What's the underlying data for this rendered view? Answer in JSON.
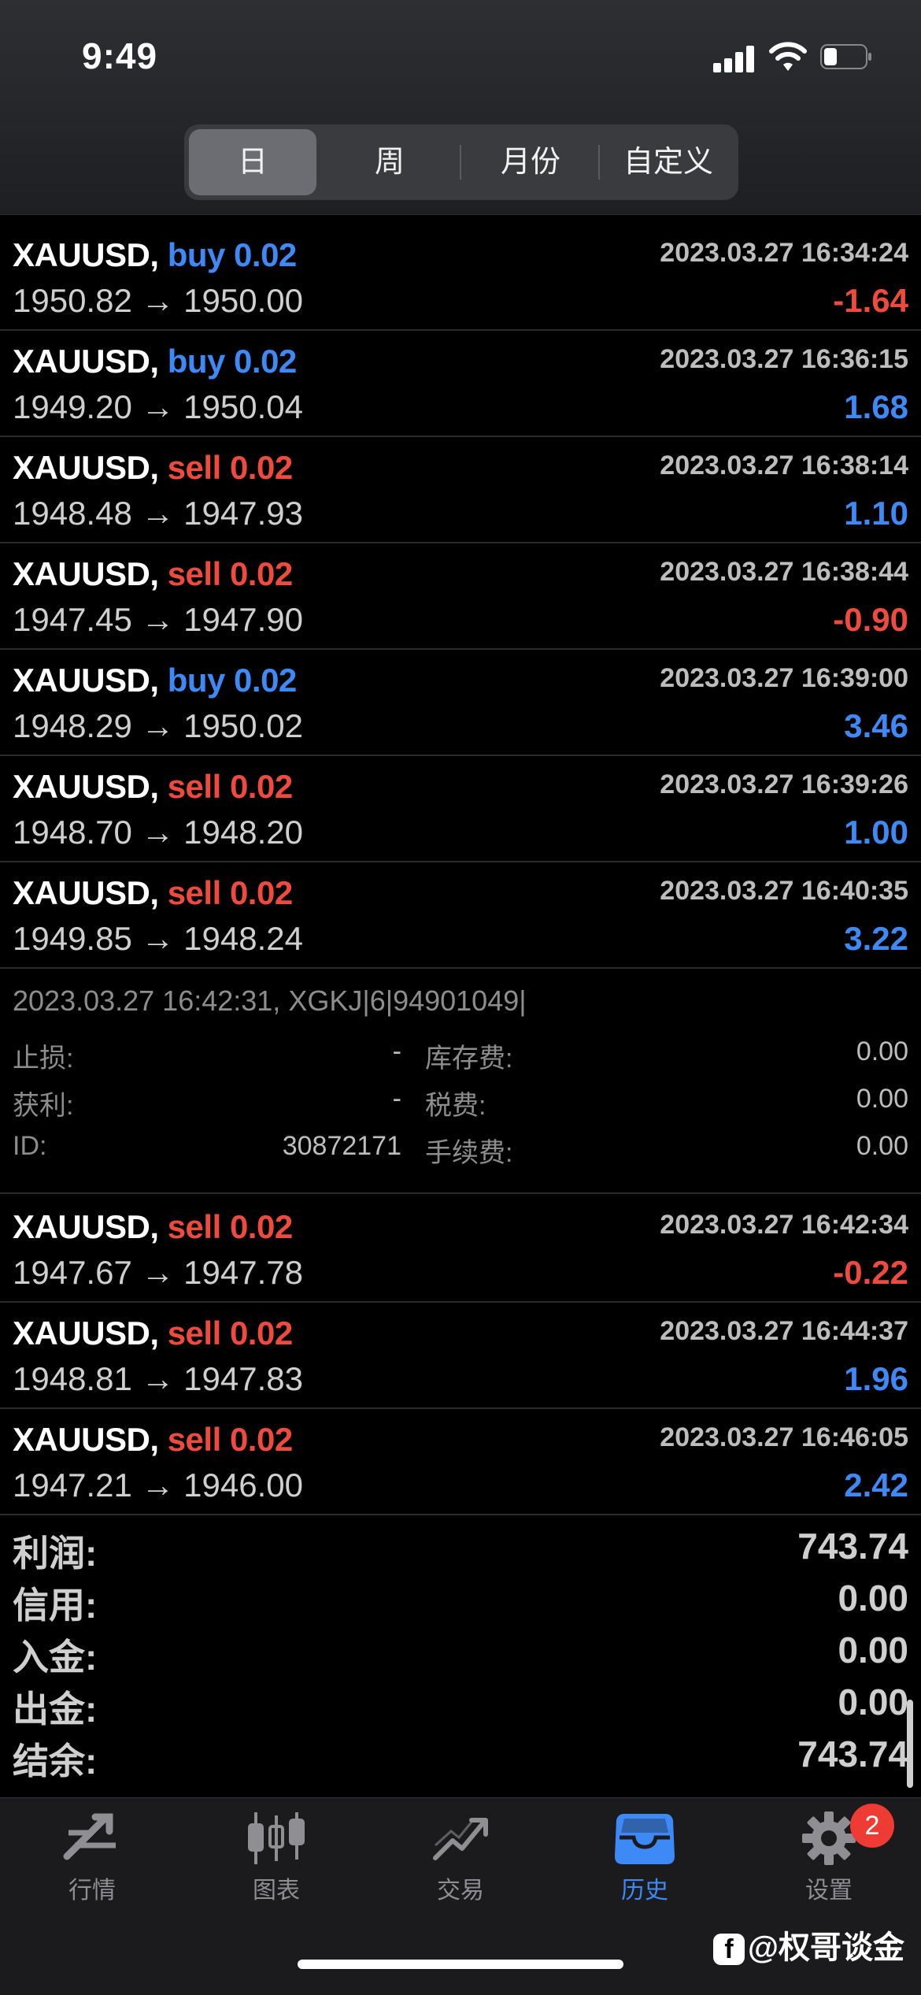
{
  "status_bar": {
    "time": "9:49"
  },
  "period_tabs": [
    "日",
    "周",
    "月份",
    "自定义"
  ],
  "active_period": "日",
  "trades_before": [
    {
      "symbol": "XAUUSD,",
      "side": "buy",
      "volume": "0.02",
      "time": "2023.03.27 16:34:24",
      "prices": "1950.82 → 1950.00",
      "profit": "-1.64"
    },
    {
      "symbol": "XAUUSD,",
      "side": "buy",
      "volume": "0.02",
      "time": "2023.03.27 16:36:15",
      "prices": "1949.20 → 1950.04",
      "profit": "1.68"
    },
    {
      "symbol": "XAUUSD,",
      "side": "sell",
      "volume": "0.02",
      "time": "2023.03.27 16:38:14",
      "prices": "1948.48 → 1947.93",
      "profit": "1.10"
    },
    {
      "symbol": "XAUUSD,",
      "side": "sell",
      "volume": "0.02",
      "time": "2023.03.27 16:38:44",
      "prices": "1947.45 → 1947.90",
      "profit": "-0.90"
    },
    {
      "symbol": "XAUUSD,",
      "side": "buy",
      "volume": "0.02",
      "time": "2023.03.27 16:39:00",
      "prices": "1948.29 → 1950.02",
      "profit": "3.46"
    },
    {
      "symbol": "XAUUSD,",
      "side": "sell",
      "volume": "0.02",
      "time": "2023.03.27 16:39:26",
      "prices": "1948.70 → 1948.20",
      "profit": "1.00"
    },
    {
      "symbol": "XAUUSD,",
      "side": "sell",
      "volume": "0.02",
      "time": "2023.03.27 16:40:35",
      "prices": "1949.85 → 1948.24",
      "profit": "3.22"
    }
  ],
  "detail": {
    "title": "2023.03.27 16:42:31, XGKJ|6|94901049|",
    "stop_loss_label": "止损:",
    "stop_loss": "-",
    "take_profit_label": "获利:",
    "take_profit": "-",
    "id_label": "ID:",
    "id": "30872171",
    "swap_label": "库存费:",
    "swap": "0.00",
    "tax_label": "税费:",
    "tax": "0.00",
    "commission_label": "手续费:",
    "commission": "0.00"
  },
  "trades_after": [
    {
      "symbol": "XAUUSD,",
      "side": "sell",
      "volume": "0.02",
      "time": "2023.03.27 16:42:34",
      "prices": "1947.67 → 1947.78",
      "profit": "-0.22"
    },
    {
      "symbol": "XAUUSD,",
      "side": "sell",
      "volume": "0.02",
      "time": "2023.03.27 16:44:37",
      "prices": "1948.81 → 1947.83",
      "profit": "1.96"
    },
    {
      "symbol": "XAUUSD,",
      "side": "sell",
      "volume": "0.02",
      "time": "2023.03.27 16:46:05",
      "prices": "1947.21 → 1946.00",
      "profit": "2.42"
    }
  ],
  "summary": [
    {
      "label": "利润:",
      "value": "743.74"
    },
    {
      "label": "信用:",
      "value": "0.00"
    },
    {
      "label": "入金:",
      "value": "0.00"
    },
    {
      "label": "出金:",
      "value": "0.00"
    },
    {
      "label": "结余:",
      "value": "743.74"
    }
  ],
  "tabbar": {
    "items": [
      {
        "label": "行情",
        "icon": "quotes-icon"
      },
      {
        "label": "图表",
        "icon": "candlestick-chart-icon"
      },
      {
        "label": "交易",
        "icon": "trade-icon"
      },
      {
        "label": "历史",
        "icon": "history-inbox-icon"
      },
      {
        "label": "设置",
        "icon": "gear-icon"
      }
    ],
    "active": "历史",
    "settings_badge": "2"
  },
  "watermark": "@权哥谈金",
  "colors": {
    "buy": "#3d8af7",
    "sell": "#ee4b3e",
    "active_tab": "#3d8af7",
    "badge": "#ee3b33"
  }
}
